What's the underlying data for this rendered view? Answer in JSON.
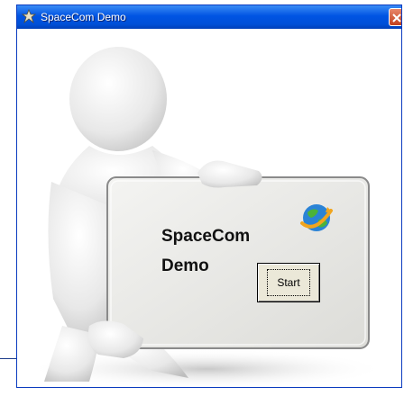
{
  "window": {
    "title": "SpaceCom Demo"
  },
  "board": {
    "line1": "SpaceCom",
    "line2": "Demo"
  },
  "start_button": {
    "label": "Start"
  },
  "icons": {
    "app": "app-icon",
    "close": "close-icon",
    "globe": "globe-icon"
  },
  "colors": {
    "titlebar": "#0054e3",
    "close": "#d34a26",
    "button_face": "#ebe8d8"
  }
}
